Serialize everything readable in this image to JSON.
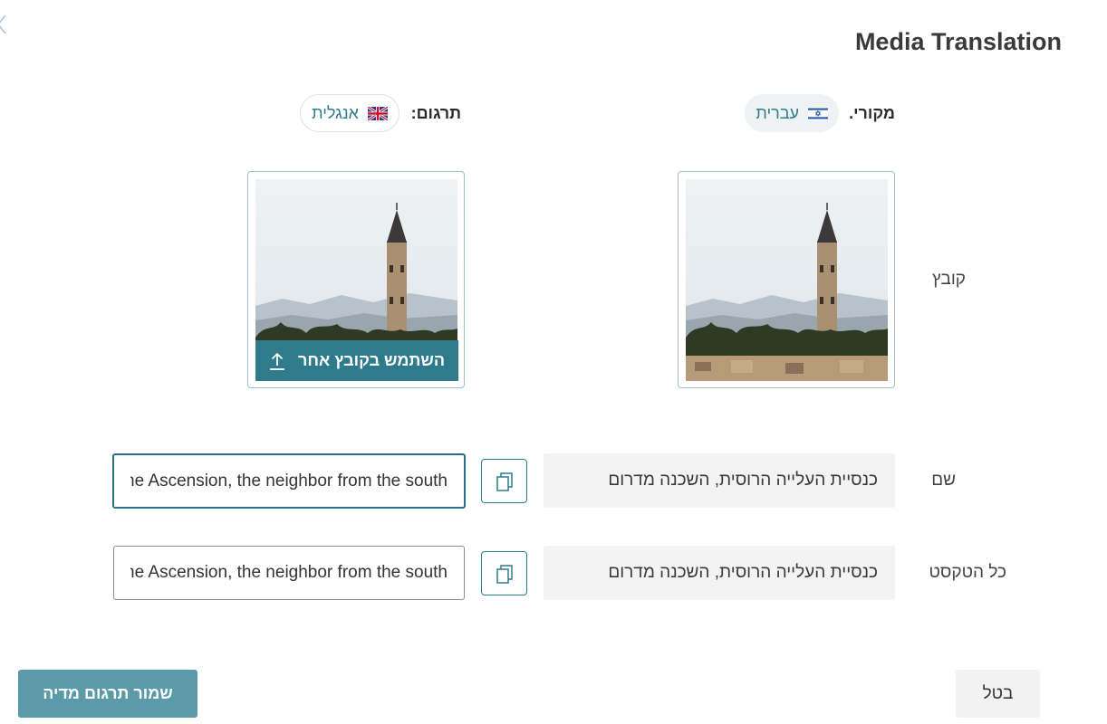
{
  "header": {
    "title": "Media Translation",
    "back_icon": "chevron-left-icon"
  },
  "languages": {
    "source_label": "מקורי.",
    "source_language": "עברית",
    "source_flag": "israel-flag-icon",
    "target_label": "תרגום:",
    "target_language": "אנגלית",
    "target_flag": "uk-flag-icon"
  },
  "rows": {
    "file_label": "קובץ",
    "name_label": "שם",
    "alltext_label": "כל הטקסט"
  },
  "file": {
    "replace_button_label": "השתמש בקובץ אחר",
    "upload_icon": "upload-icon",
    "image_subject": "Church bell tower over city skyline"
  },
  "name": {
    "source_value": "כנסיית העלייה הרוסית, השכנה מדרום",
    "target_value": "Russian Orthodox Convent of the Ascension, the neighbor from the south",
    "copy_icon": "copy-icon"
  },
  "alltext": {
    "source_value": "כנסיית העלייה הרוסית, השכנה מדרום",
    "target_value": "Russian Orthodox Convent of the Ascension, the neighbor from the south",
    "copy_icon": "copy-icon"
  },
  "footer": {
    "cancel_label": "בטל",
    "save_label": "שמור תרגום מדיה"
  },
  "colors": {
    "accent": "#2f7a8b",
    "save_button": "#5a9aa9",
    "source_box": "#f3f3f3"
  }
}
